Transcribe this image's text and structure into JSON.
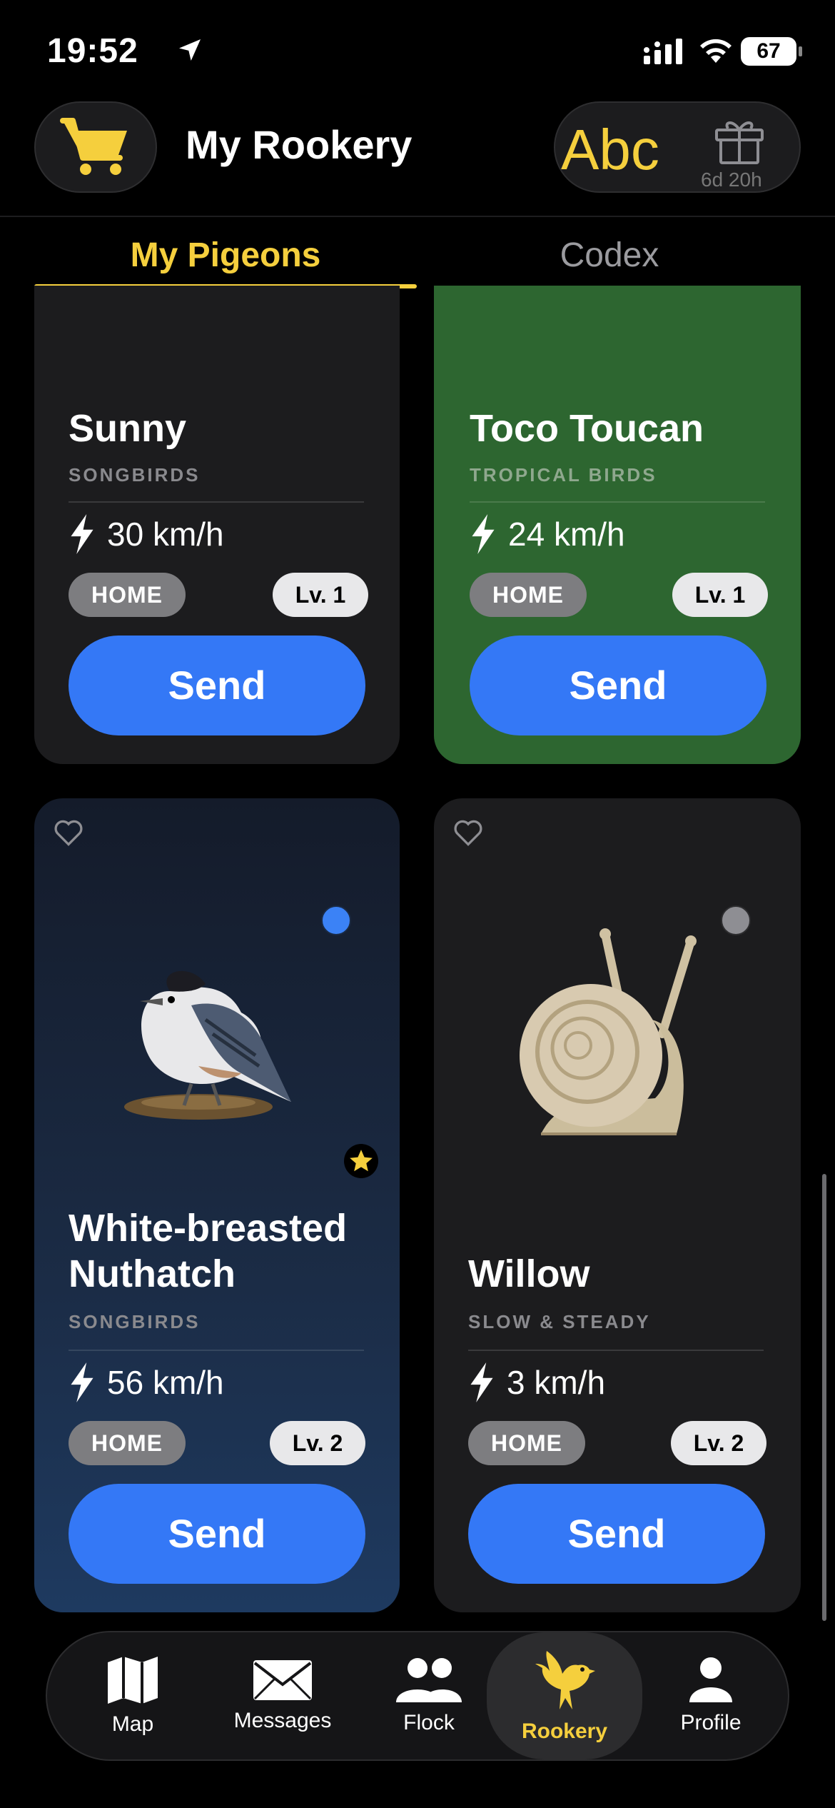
{
  "status_bar": {
    "time": "19:52",
    "battery": "67"
  },
  "header": {
    "title": "My Rookery",
    "abc_label": "Abc",
    "gift_timer": "6d 20h"
  },
  "tabs": [
    {
      "label": "My Pigeons",
      "active": true
    },
    {
      "label": "Codex",
      "active": false
    }
  ],
  "cards": [
    {
      "name": "Sunny",
      "category": "SONGBIRDS",
      "speed": "30 km/h",
      "home": "HOME",
      "level": "Lv. 1",
      "send": "Send",
      "background": "#1c1c1e"
    },
    {
      "name": "Toco Toucan",
      "category": "TROPICAL BIRDS",
      "speed": "24 km/h",
      "home": "HOME",
      "level": "Lv. 1",
      "send": "Send",
      "background": "#2d6630"
    },
    {
      "name_line1": "White-breasted",
      "name_line2": "Nuthatch",
      "category": "SONGBIRDS",
      "speed": "56 km/h",
      "home": "HOME",
      "level": "Lv. 2",
      "send": "Send",
      "status_dot": "#3b82f6",
      "starred": true
    },
    {
      "name": "Willow",
      "category": "SLOW & STEADY",
      "speed": "3 km/h",
      "home": "HOME",
      "level": "Lv. 2",
      "send": "Send",
      "status_dot": "#8e8e93"
    }
  ],
  "nav": [
    {
      "label": "Map",
      "icon": "map-icon"
    },
    {
      "label": "Messages",
      "icon": "envelope-icon"
    },
    {
      "label": "Flock",
      "icon": "people-icon"
    },
    {
      "label": "Rookery",
      "icon": "bird-icon",
      "active": true
    },
    {
      "label": "Profile",
      "icon": "person-icon"
    }
  ],
  "colors": {
    "accent": "#f5cf3d",
    "button": "#3478f6"
  }
}
